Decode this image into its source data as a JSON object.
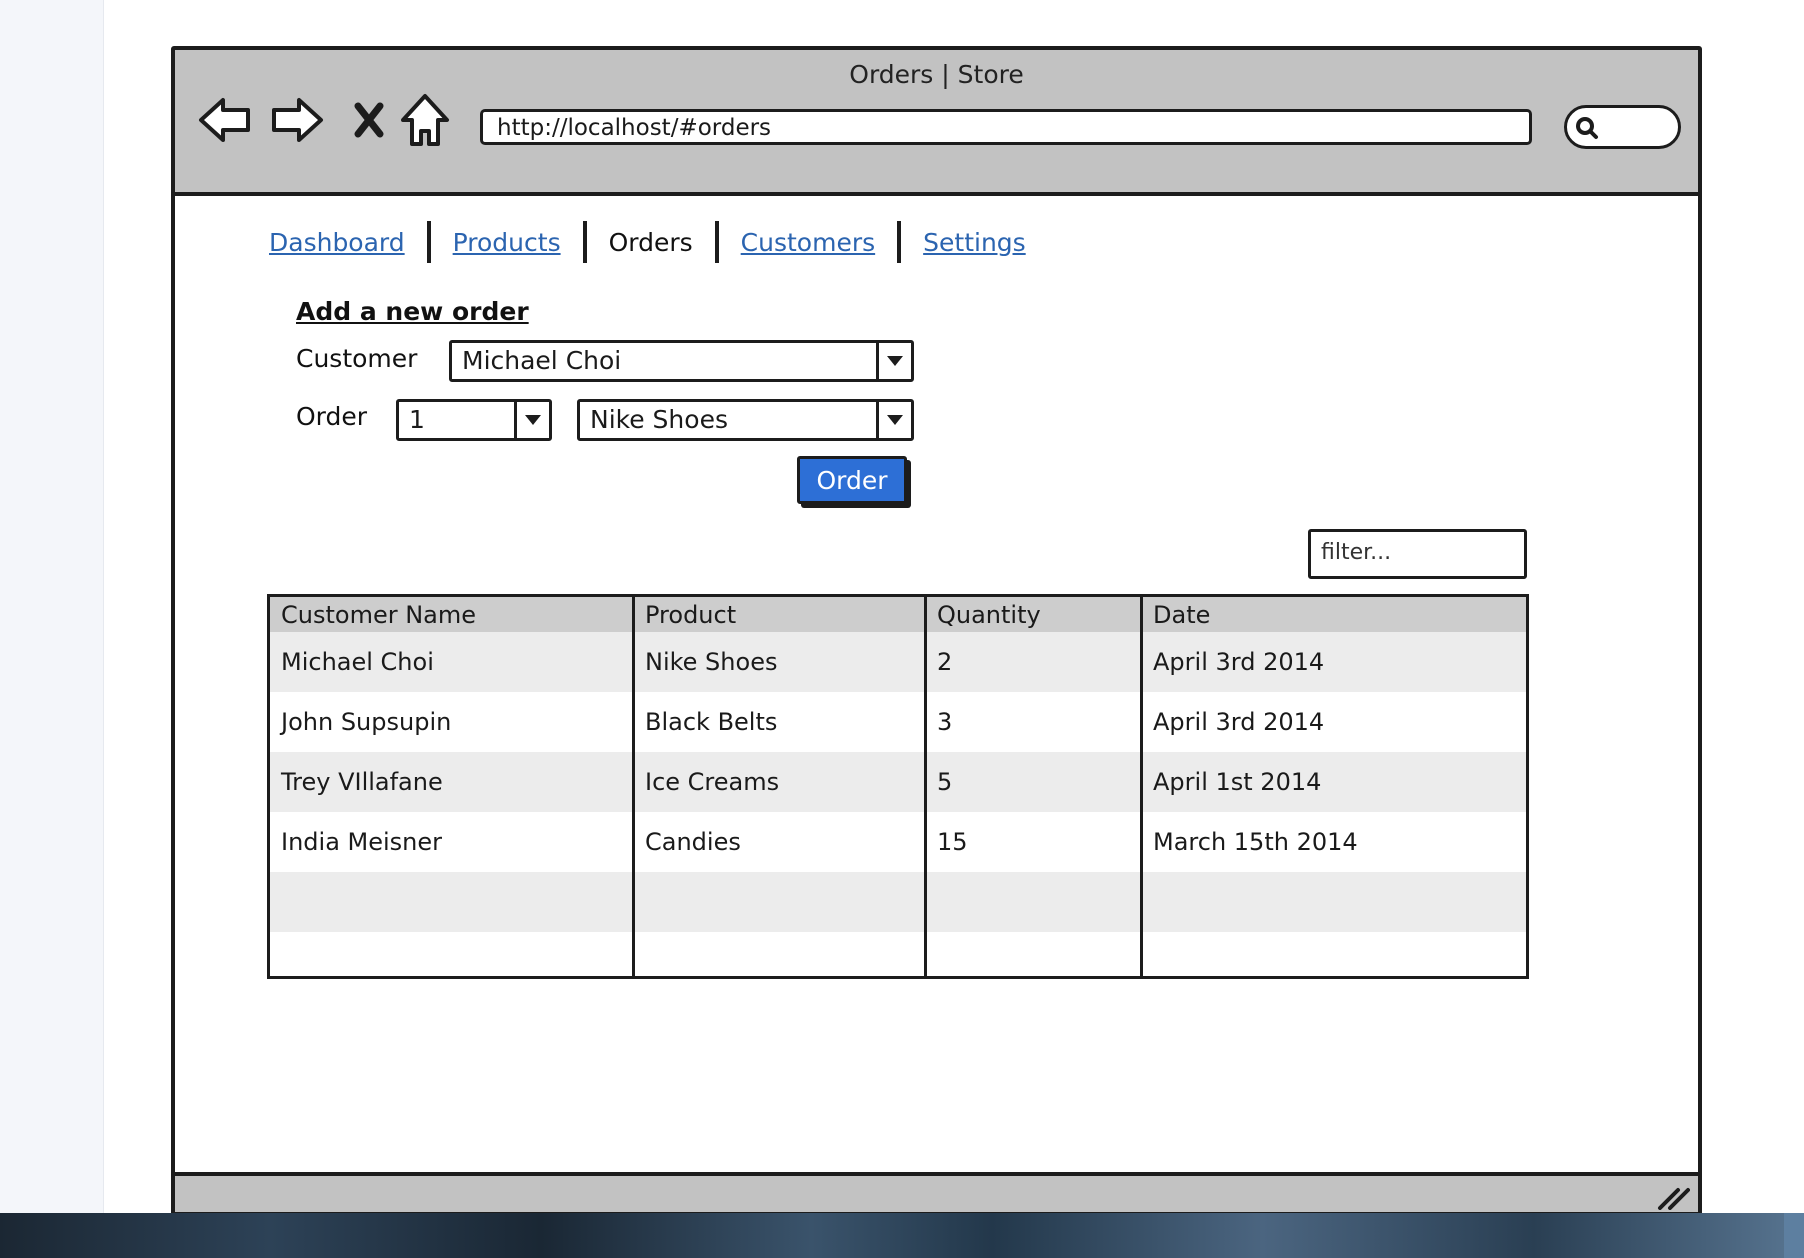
{
  "window": {
    "title": "Orders | Store",
    "url": "http://localhost/#orders"
  },
  "nav": {
    "tabs": [
      {
        "label": "Dashboard",
        "active": false
      },
      {
        "label": "Products",
        "active": false
      },
      {
        "label": "Orders",
        "active": true
      },
      {
        "label": "Customers",
        "active": false
      },
      {
        "label": "Settings",
        "active": false
      }
    ]
  },
  "form": {
    "title": "Add a new order",
    "customer_label": "Customer",
    "customer_value": "Michael Choi",
    "order_label": "Order",
    "quantity_value": "1",
    "product_value": "Nike Shoes",
    "submit_label": "Order"
  },
  "filter": {
    "placeholder": "filter..."
  },
  "table": {
    "columns": [
      "Customer Name",
      "Product",
      "Quantity",
      "Date"
    ],
    "rows": [
      [
        "Michael Choi",
        "Nike Shoes",
        "2",
        "April 3rd 2014"
      ],
      [
        "John Supsupin",
        "Black Belts",
        "3",
        "April 3rd 2014"
      ],
      [
        "Trey VIllafane",
        "Ice Creams",
        "5",
        "April 1st 2014"
      ],
      [
        "India Meisner",
        "Candies",
        "15",
        "March 15th 2014"
      ],
      [
        "",
        "",
        "",
        ""
      ],
      [
        "",
        "",
        "",
        ""
      ]
    ]
  },
  "colors": {
    "link": "#2b64b0",
    "button": "#2d6fd6",
    "chrome": "#c2c2c2",
    "header_row": "#cdcdcd",
    "alt_row": "#ececec"
  },
  "icons": [
    "back-arrow-icon",
    "forward-arrow-icon",
    "stop-icon",
    "home-icon",
    "search-icon",
    "dropdown-arrow-icon",
    "resize-grip-icon"
  ]
}
